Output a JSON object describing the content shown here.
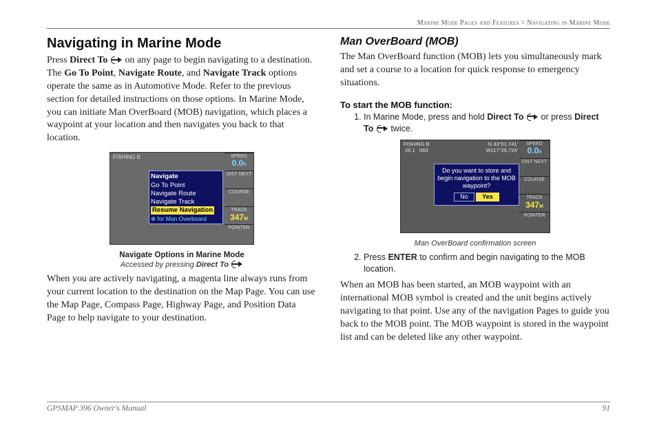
{
  "breadcrumb": {
    "section": "Marine Mode Pages and Features",
    "sep": ">",
    "page": "Navigating in Marine Mode"
  },
  "left": {
    "h1": "Navigating in Marine Mode",
    "p1a": "Press ",
    "p1b": "Direct To",
    "p1c": " on any page to begin navigating to a destination. The ",
    "p1d": "Go To Point",
    "p1e": ", ",
    "p1f": "Navigate Route",
    "p1g": ", and ",
    "p1h": "Navigate Track",
    "p1i": " options operate the same as in Automotive Mode. Refer to the previous section for detailed instructions on those options. In Marine Mode, you can initiate Man OverBoard (MOB) navigation, which places a waypoint at your location and then navigates you back to that location.",
    "figcap1": "Navigate Options in Marine Mode",
    "figcap2a": "Accessed by pressing ",
    "figcap2b": "Direct To",
    "p2": "When you are actively navigating, a magenta line always runs from your current location to the destination on the Map Page. You can use the Map Page, Compass Page, Highway Page, and Position Data Page to help navigate to your destination."
  },
  "scr1": {
    "top": "FISHING B",
    "cells": {
      "speed_label": "SPEED",
      "speed_val": "0.0",
      "dist_label": "DIST NEXT",
      "course_label": "COURSE",
      "track_label": "TRACK",
      "track_val": "347",
      "pointer_label": "POINTER"
    },
    "popup": {
      "title": "Navigate",
      "items": [
        "Go To Point",
        "Navigate Route",
        "Navigate Track"
      ],
      "selected": "Resume Navigation",
      "hint": "⊕ for Man Overboard"
    }
  },
  "right": {
    "h2": "Man OverBoard (MOB)",
    "p1": "The Man OverBoard function (MOB) lets you simultaneously mark and set a course to a location for quick response to emergency situations.",
    "h3": "To start the MOB function:",
    "li1a": "In Marine Mode, press and hold ",
    "li1b": "Direct To",
    "li1c": " or press ",
    "li1d": "Direct To",
    "li1e": " twice.",
    "figcap": "Man OverBoard confirmation screen",
    "li2a": "Press ",
    "li2b": "ENTER",
    "li2c": " to confirm and begin navigating to the MOB location.",
    "p2": "When an MOB has been started, an MOB waypoint with an international MOB symbol is created and the unit begins actively navigating to that point. Use any of the navigation Pages to guide you back to the MOB point. The MOB waypoint is stored in the waypoint list and can be deleted like any other waypoint."
  },
  "scr2": {
    "top_left": "FISHING B\n26.1   063",
    "top_right": "N 33°01.741'\nW117°25.724'",
    "dialog": {
      "msg": "Do you want to store and begin navigation to the MOB waypoint?",
      "no": "No",
      "yes": "Yes"
    },
    "cells": {
      "speed_label": "SPEED",
      "speed_val": "0.0",
      "dist_label": "DIST NEXT",
      "course_label": "COURSE",
      "track_label": "TRACK",
      "track_val": "347",
      "pointer_label": "POINTER"
    }
  },
  "footer": {
    "left": "GPSMAP 396 Owner's Manual",
    "right": "91"
  }
}
